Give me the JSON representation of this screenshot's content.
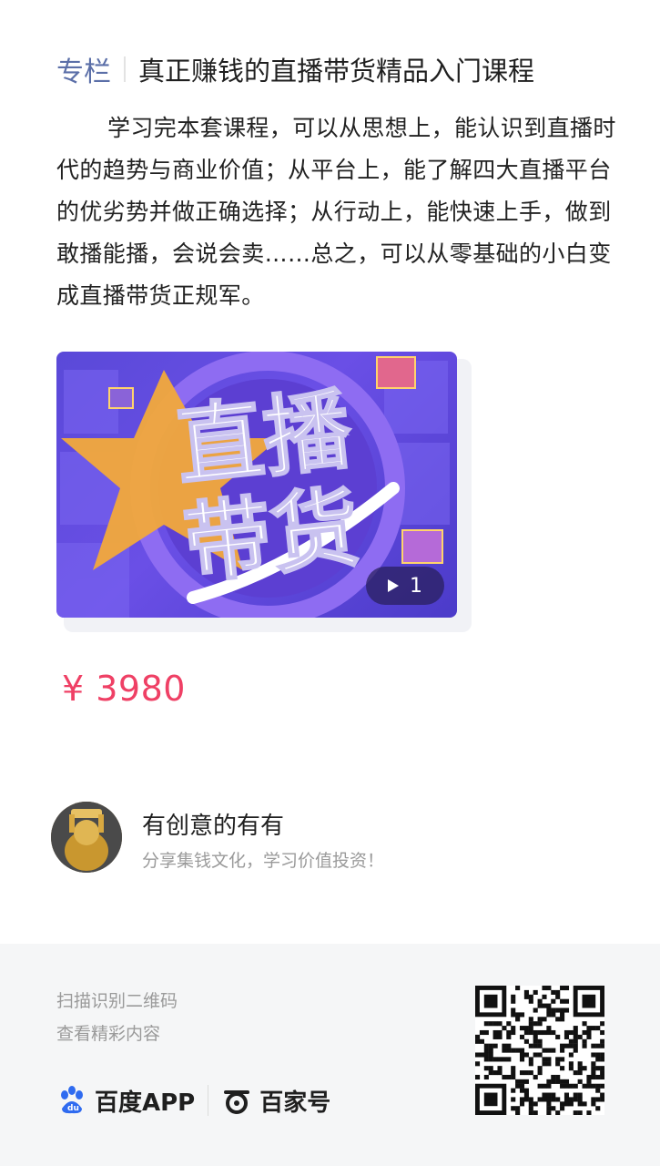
{
  "header": {
    "tag": "专栏",
    "title": "真正赚钱的直播带货精品入门课程"
  },
  "description": "学习完本套课程，可以从思想上，能认识到直播时代的趋势与商业价值；从平台上，能了解四大直播平台的优劣势并做正确选择；从行动上，能快速上手，做到敢播能播，会说会卖……总之，可以从零基础的小白变成直播带货正规军。",
  "cover": {
    "art_text_line1": "直播",
    "art_text_line2": "带货",
    "video_count": "1"
  },
  "price": "¥ 3980",
  "author": {
    "name": "有创意的有有",
    "bio": "分享集钱文化，学习价值投资！"
  },
  "footer": {
    "scan_line1": "扫描识别二维码",
    "scan_line2": "查看精彩内容",
    "brand1": "百度APP",
    "brand2": "百家号"
  },
  "colors": {
    "tag": "#5b6fa8",
    "price": "#ef4065",
    "footer_bg": "#f5f6f7"
  }
}
